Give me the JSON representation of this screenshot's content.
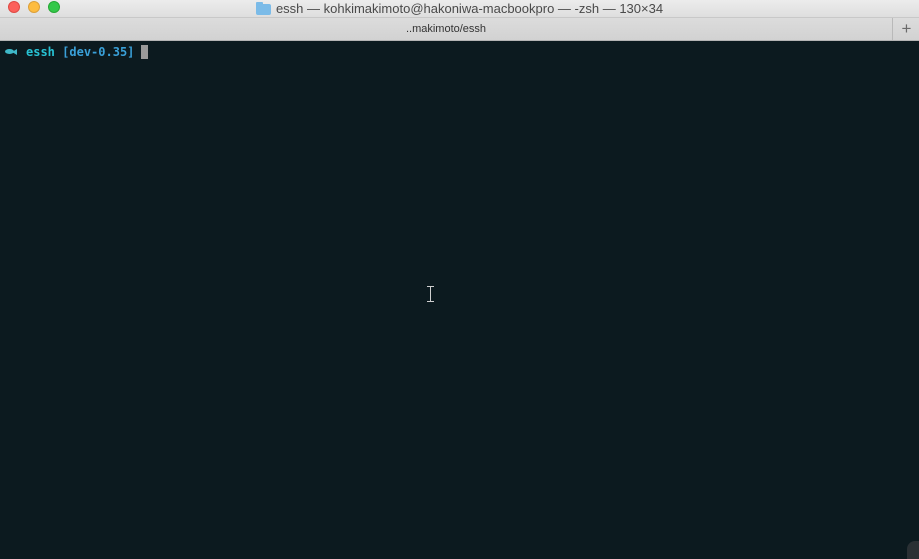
{
  "window": {
    "title": "essh — kohkimakimoto@hakoniwa-macbookpro — -zsh — 130×34",
    "folder_icon": "folder-icon"
  },
  "tabs": [
    {
      "label": "..makimoto/essh",
      "active": true
    }
  ],
  "new_tab_label": "+",
  "terminal": {
    "prompt_icon": "fish-icon",
    "prompt_dir": "essh",
    "prompt_branch": "[dev-0.35]",
    "input": "",
    "colors": {
      "background": "#0c1a1f",
      "prompt_dir": "#27c3d4",
      "prompt_branch": "#3aa0d8",
      "cursor": "#9a9a9a"
    }
  },
  "mouse_cursor_icon": "ibeam-icon"
}
